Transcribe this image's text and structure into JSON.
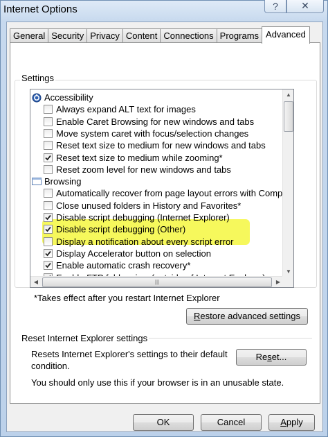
{
  "window": {
    "title": "Internet Options",
    "help_glyph": "?",
    "close_glyph": "✕"
  },
  "tabs": [
    {
      "label": "General",
      "active": false
    },
    {
      "label": "Security",
      "active": false
    },
    {
      "label": "Privacy",
      "active": false
    },
    {
      "label": "Content",
      "active": false
    },
    {
      "label": "Connections",
      "active": false
    },
    {
      "label": "Programs",
      "active": false
    },
    {
      "label": "Advanced",
      "active": true
    }
  ],
  "settings": {
    "group_label": "Settings",
    "tree": [
      {
        "type": "category",
        "label": "Accessibility",
        "icon": "accessibility-icon"
      },
      {
        "type": "option",
        "label": "Always expand ALT text for images",
        "checked": false
      },
      {
        "type": "option",
        "label": "Enable Caret Browsing for new windows and tabs",
        "checked": false
      },
      {
        "type": "option",
        "label": "Move system caret with focus/selection changes",
        "checked": false
      },
      {
        "type": "option",
        "label": "Reset text size to medium for new windows and tabs",
        "checked": false
      },
      {
        "type": "option",
        "label": "Reset text size to medium while zooming*",
        "checked": true
      },
      {
        "type": "option",
        "label": "Reset zoom level for new windows and tabs",
        "checked": false
      },
      {
        "type": "category",
        "label": "Browsing",
        "icon": "browsing-icon"
      },
      {
        "type": "option",
        "label": "Automatically recover from page layout errors with Compat",
        "checked": false
      },
      {
        "type": "option",
        "label": "Close unused folders in History and Favorites*",
        "checked": false
      },
      {
        "type": "option",
        "label": "Disable script debugging (Internet Explorer)",
        "checked": true
      },
      {
        "type": "option",
        "label": "Disable script debugging (Other)",
        "checked": true
      },
      {
        "type": "option",
        "label": "Display a notification about every script error",
        "checked": false
      },
      {
        "type": "option",
        "label": "Display Accelerator button on selection",
        "checked": true
      },
      {
        "type": "option",
        "label": "Enable automatic crash recovery*",
        "checked": true
      },
      {
        "type": "option",
        "label": "Enable FTP folder view (outside of Internet Explorer)",
        "checked": true
      }
    ],
    "highlight_color": "#f5f74a"
  },
  "note": "*Takes effect after you restart Internet Explorer",
  "restore_button": {
    "pre": "",
    "accel": "R",
    "post": "estore advanced settings"
  },
  "reset": {
    "group_label": "Reset Internet Explorer settings",
    "description": "Resets Internet Explorer's settings to their default condition.",
    "button": {
      "pre": "Re",
      "accel": "s",
      "post": "et..."
    },
    "warning": "You should only use this if your browser is in an unusable state."
  },
  "dialog_buttons": {
    "ok": "OK",
    "cancel": "Cancel",
    "apply": {
      "pre": "",
      "accel": "A",
      "post": "pply"
    }
  },
  "scroll_glyphs": {
    "up": "▲",
    "down": "▼",
    "left": "◀",
    "right": "▶",
    "grip": "|||"
  }
}
